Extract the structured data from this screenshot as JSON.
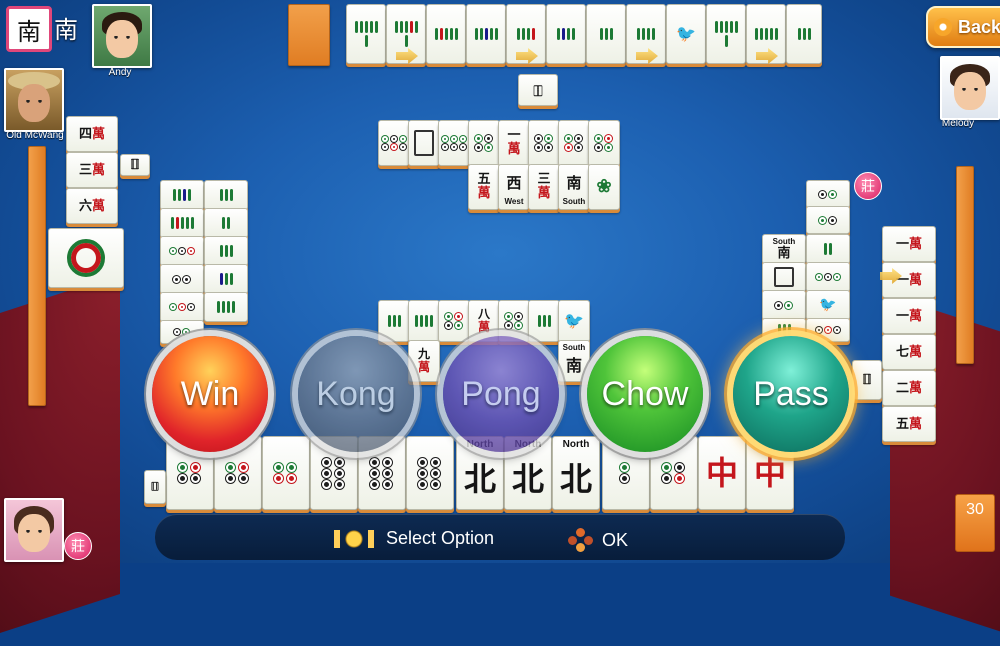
{
  "status": {
    "round_wind": "南",
    "seat_wind": "南",
    "dealer_mark": "莊",
    "tiles_remaining": "30"
  },
  "players": {
    "top": "Andy",
    "left": "Old McWang",
    "right": "Melody"
  },
  "back_button": {
    "label": "Back"
  },
  "actions": {
    "win": "Win",
    "kong": "Kong",
    "pong": "Pong",
    "chow": "Chow",
    "pass": "Pass"
  },
  "hints": {
    "select": "Select Option",
    "ok": "OK"
  },
  "hand": {
    "north_label_1": "North",
    "north_label_2": "North",
    "north_label_3": "North",
    "north_char": "北",
    "red_dragon_char": "中",
    "south_label": "South",
    "south_char": "南",
    "west_label": "West",
    "wan_char": "萬"
  },
  "discards": {
    "chars": [
      "一",
      "西",
      "三",
      "南",
      "五",
      "八",
      "九",
      "四",
      "七",
      "二",
      "六"
    ]
  },
  "colors": {
    "felt": "#1c5fb0",
    "tile_back": "#e07d23",
    "accent_pink": "#e0477a"
  }
}
